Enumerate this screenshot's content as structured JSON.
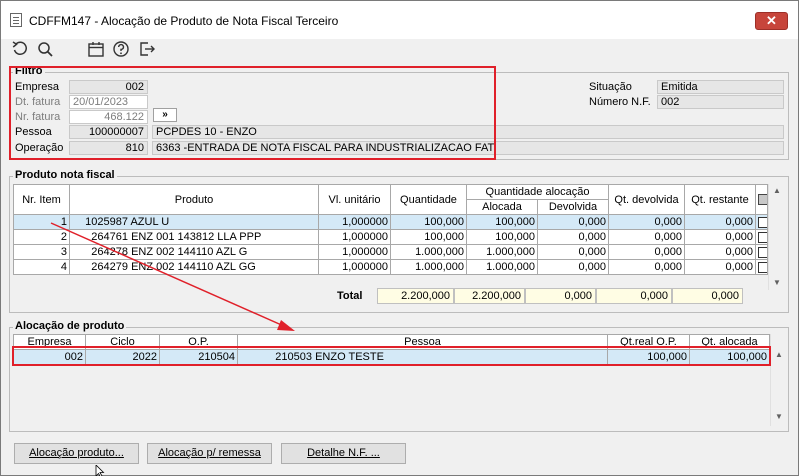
{
  "window": {
    "title": "CDFFM147 - Alocação de Produto de Nota Fiscal Terceiro",
    "close_label": "✕"
  },
  "toolbar": {
    "icons": [
      "refresh-icon",
      "search-icon",
      "calendar-icon",
      "help-icon",
      "exit-icon"
    ]
  },
  "filtro": {
    "title": "Filtro",
    "empresa_label": "Empresa",
    "empresa_value": "002",
    "dt_fatura_label": "Dt. fatura",
    "dt_fatura_value": "20/01/2023",
    "nr_fatura_label": "Nr. fatura",
    "nr_fatura_value": "468.122",
    "nr_fatura_button": "»",
    "pessoa_label": "Pessoa",
    "pessoa_code": "100000007",
    "pessoa_name": "PCPDES 10 - ENZO",
    "operacao_label": "Operação",
    "operacao_code": "810",
    "operacao_desc": "6363 -ENTRADA DE NOTA FISCAL PARA INDUSTRIALIZACAO FAT.",
    "situacao_label": "Situação",
    "situacao_value": "Emitida",
    "numero_nf_label": "Número N.F.",
    "numero_nf_value": "002"
  },
  "produto_nf": {
    "title": "Produto nota fiscal",
    "headers": {
      "nr_item": "Nr. Item",
      "produto": "Produto",
      "vl_unitario": "Vl. unitário",
      "quantidade": "Quantidade",
      "qtd_alocacao": "Quantidade alocação",
      "alocada": "Alocada",
      "devolvida": "Devolvida",
      "qt_devolvida": "Qt. devolvida",
      "qt_restante": "Qt. restante"
    },
    "rows": [
      {
        "nr": "1",
        "codigo": "1025987",
        "descricao": "AZUL U",
        "vl_unitario": "1,000000",
        "quantidade": "100,000",
        "alocada": "100,000",
        "devolvida": "0,000",
        "qt_devolvida": "0,000",
        "qt_restante": "0,000"
      },
      {
        "nr": "2",
        "codigo": "264761",
        "descricao": "ENZ 001 143812 LLA PPP",
        "vl_unitario": "1,000000",
        "quantidade": "100,000",
        "alocada": "100,000",
        "devolvida": "0,000",
        "qt_devolvida": "0,000",
        "qt_restante": "0,000"
      },
      {
        "nr": "3",
        "codigo": "264278",
        "descricao": "ENZ 002 144110 AZL G",
        "vl_unitario": "1,000000",
        "quantidade": "1.000,000",
        "alocada": "1.000,000",
        "devolvida": "0,000",
        "qt_devolvida": "0,000",
        "qt_restante": "0,000"
      },
      {
        "nr": "4",
        "codigo": "264279",
        "descricao": "ENZ 002 144110 AZL GG",
        "vl_unitario": "1,000000",
        "quantidade": "1.000,000",
        "alocada": "1.000,000",
        "devolvida": "0,000",
        "qt_devolvida": "0,000",
        "qt_restante": "0,000"
      }
    ],
    "total_label": "Total",
    "totals": {
      "quantidade": "2.200,000",
      "alocada": "2.200,000",
      "devolvida": "0,000",
      "qt_devolvida": "0,000",
      "qt_restante": "0,000"
    }
  },
  "alocacao": {
    "title": "Alocação de produto",
    "headers": {
      "empresa": "Empresa",
      "ciclo": "Ciclo",
      "op": "O.P.",
      "pessoa": "Pessoa",
      "qt_real_op": "Qt.real O.P.",
      "qt_alocada": "Qt. alocada"
    },
    "rows": [
      {
        "empresa": "002",
        "ciclo": "2022",
        "op": "210504",
        "pessoa_code": "210503",
        "pessoa_name": "ENZO TESTE",
        "qt_real_op": "100,000",
        "qt_alocada": "100,000"
      }
    ]
  },
  "buttons": {
    "alocacao_produto": "Alocação produto...",
    "alocacao_remessa": "Alocação p/ remessa",
    "detalhe_nf": "Detalhe N.F. ..."
  },
  "colors": {
    "highlight_red": "#e0202a",
    "selected_row": "#d4e9f7",
    "total_bg": "#fffde4"
  }
}
